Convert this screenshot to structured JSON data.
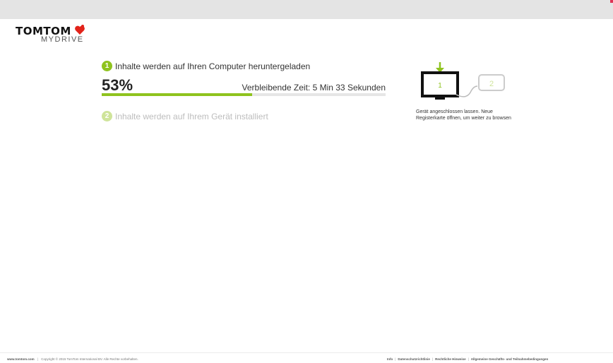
{
  "logo": {
    "brand": "TOMTOM",
    "sub": "MYDRIVE"
  },
  "step1": {
    "number": "1",
    "label": "Inhalte werden auf Ihren Computer heruntergeladen"
  },
  "progress": {
    "percent_text": "53%",
    "value": 0.53,
    "remaining": "Verbleibende Zeit: 5 Min 33 Sekunden",
    "fill_color": "#8fc31f"
  },
  "step2": {
    "number": "2",
    "label": "Inhalte werden auf Ihrem Gerät installiert"
  },
  "illustration": {
    "screen1": "1",
    "screen2": "2",
    "icons": [
      "download-arrow-icon",
      "monitor-icon",
      "device-icon"
    ]
  },
  "hint": {
    "line1": "Gerät angeschlossen lassen. Neue",
    "line2": "Registerkarte öffnen, um weiter zu browsen"
  },
  "footer": {
    "site": "www.tomtom.com",
    "copyright": "Copyright © 2015 TomTom International BV. Alle Rechte vorbehalten.",
    "links": [
      "Info",
      "Datenschutzrichtlinie",
      "Rechtliche Hinweise",
      "Allgemeine Geschäfts- und Teilnahmebedingungen"
    ]
  }
}
